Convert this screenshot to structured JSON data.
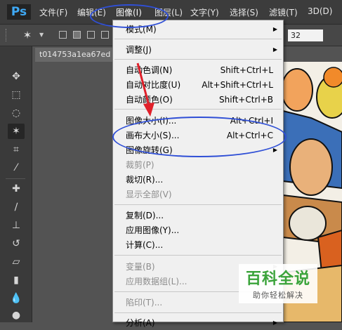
{
  "app": {
    "logo": "Ps"
  },
  "menubar": {
    "items": [
      "文件(F)",
      "编辑(E)",
      "图像(I)",
      "图层(L)",
      "文字(Y)",
      "选择(S)",
      "滤镜(T)",
      "3D(D)"
    ]
  },
  "options": {
    "tolerance_value": "32"
  },
  "document": {
    "tab_title": "t014753a1ea67ed"
  },
  "image_menu": {
    "items": [
      {
        "label": "模式(M)",
        "shortcut": "",
        "submenu": true,
        "disabled": false
      },
      {
        "label": "调整(J)",
        "shortcut": "",
        "submenu": true,
        "disabled": false
      },
      {
        "label": "自动色调(N)",
        "shortcut": "Shift+Ctrl+L",
        "submenu": false,
        "disabled": false
      },
      {
        "label": "自动对比度(U)",
        "shortcut": "Alt+Shift+Ctrl+L",
        "submenu": false,
        "disabled": false
      },
      {
        "label": "自动颜色(O)",
        "shortcut": "Shift+Ctrl+B",
        "submenu": false,
        "disabled": false
      },
      {
        "label": "图像大小(I)...",
        "shortcut": "Alt+Ctrl+I",
        "submenu": false,
        "disabled": false
      },
      {
        "label": "画布大小(S)...",
        "shortcut": "Alt+Ctrl+C",
        "submenu": false,
        "disabled": false
      },
      {
        "label": "图像旋转(G)",
        "shortcut": "",
        "submenu": true,
        "disabled": false
      },
      {
        "label": "裁剪(P)",
        "shortcut": "",
        "submenu": false,
        "disabled": true
      },
      {
        "label": "裁切(R)...",
        "shortcut": "",
        "submenu": false,
        "disabled": false
      },
      {
        "label": "显示全部(V)",
        "shortcut": "",
        "submenu": false,
        "disabled": true
      },
      {
        "label": "复制(D)...",
        "shortcut": "",
        "submenu": false,
        "disabled": false
      },
      {
        "label": "应用图像(Y)...",
        "shortcut": "",
        "submenu": false,
        "disabled": false
      },
      {
        "label": "计算(C)...",
        "shortcut": "",
        "submenu": false,
        "disabled": false
      },
      {
        "label": "变量(B)",
        "shortcut": "",
        "submenu": true,
        "disabled": true
      },
      {
        "label": "应用数据组(L)...",
        "shortcut": "",
        "submenu": false,
        "disabled": true
      },
      {
        "label": "陷印(T)...",
        "shortcut": "",
        "submenu": false,
        "disabled": true
      },
      {
        "label": "分析(A)",
        "shortcut": "",
        "submenu": true,
        "disabled": false
      }
    ]
  },
  "watermark": {
    "title": "百科全说",
    "subtitle": "助你轻松解决"
  },
  "colors": {
    "highlight_ellipse": "#2f4fd6",
    "arrow": "#e0202a",
    "menu_active": "#2b6fbf"
  }
}
